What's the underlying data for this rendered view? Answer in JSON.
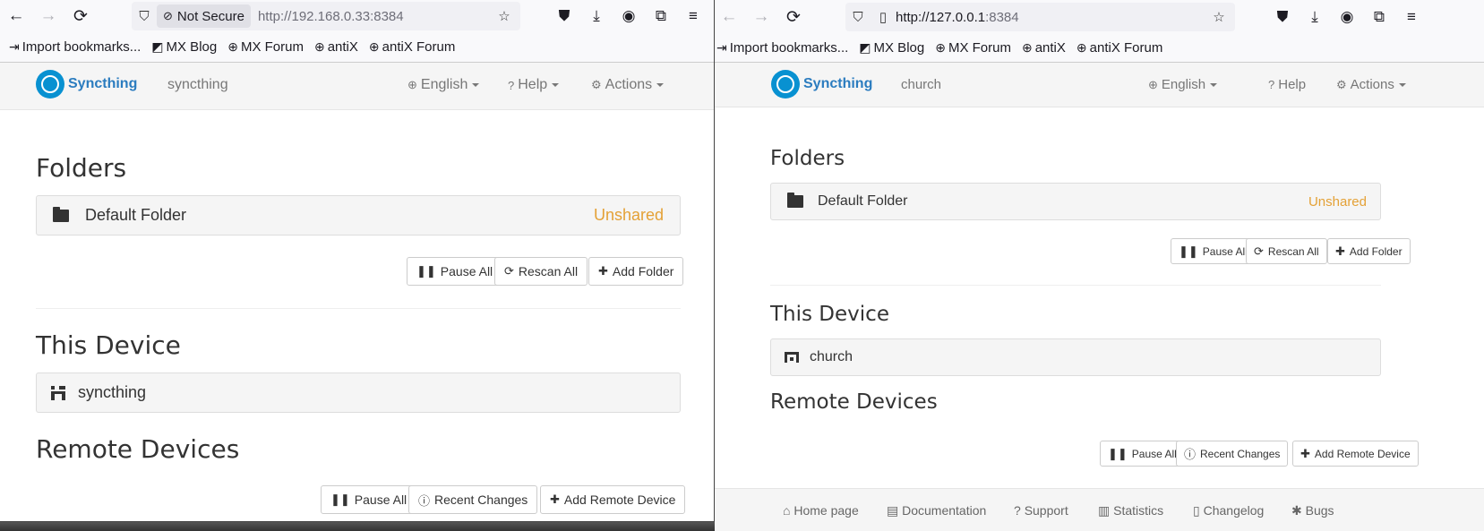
{
  "left": {
    "nav": {
      "back": "←",
      "forward": "→",
      "reload": "⟳",
      "shield": "⛉"
    },
    "url": {
      "not_secure": "Not Secure",
      "host": "http://192.168.0.33",
      "port": ":8384"
    },
    "bookmarks": [
      "Import bookmarks...",
      "MX Blog",
      "MX Forum",
      "antiX",
      "antiX Forum"
    ],
    "app": {
      "brand": "Syncthing",
      "device": "syncthing",
      "menu_language": "English",
      "menu_help": "Help",
      "menu_actions": "Actions"
    },
    "folders": {
      "title": "Folders",
      "name": "Default Folder",
      "status": "Unshared"
    },
    "folder_buttons": {
      "pause": "Pause All",
      "rescan": "Rescan All",
      "add": "Add Folder"
    },
    "this_device": {
      "title": "This Device",
      "name": "syncthing"
    },
    "remote": {
      "title": "Remote Devices",
      "pause": "Pause All",
      "recent": "Recent Changes",
      "add": "Add Remote Device"
    }
  },
  "right": {
    "url": {
      "host": "http://127.0.0.1",
      "port": ":8384"
    },
    "bookmarks": [
      "Import bookmarks...",
      "MX Blog",
      "MX Forum",
      "antiX",
      "antiX Forum"
    ],
    "app": {
      "brand": "Syncthing",
      "device": "church",
      "menu_language": "English",
      "menu_help": "Help",
      "menu_actions": "Actions"
    },
    "folders": {
      "title": "Folders",
      "name": "Default Folder",
      "status": "Unshared"
    },
    "folder_buttons": {
      "pause": "Pause All",
      "rescan": "Rescan All",
      "add": "Add Folder"
    },
    "this_device": {
      "title": "This Device",
      "name": "church"
    },
    "remote": {
      "title": "Remote Devices",
      "pause": "Pause All",
      "recent": "Recent Changes",
      "add": "Add Remote Device"
    },
    "footer": [
      "Home page",
      "Documentation",
      "Support",
      "Statistics",
      "Changelog",
      "Bugs"
    ]
  },
  "colors": {
    "brand": "#2b7cbf",
    "unshared": "#e4a136",
    "logo": "#0891d1"
  }
}
